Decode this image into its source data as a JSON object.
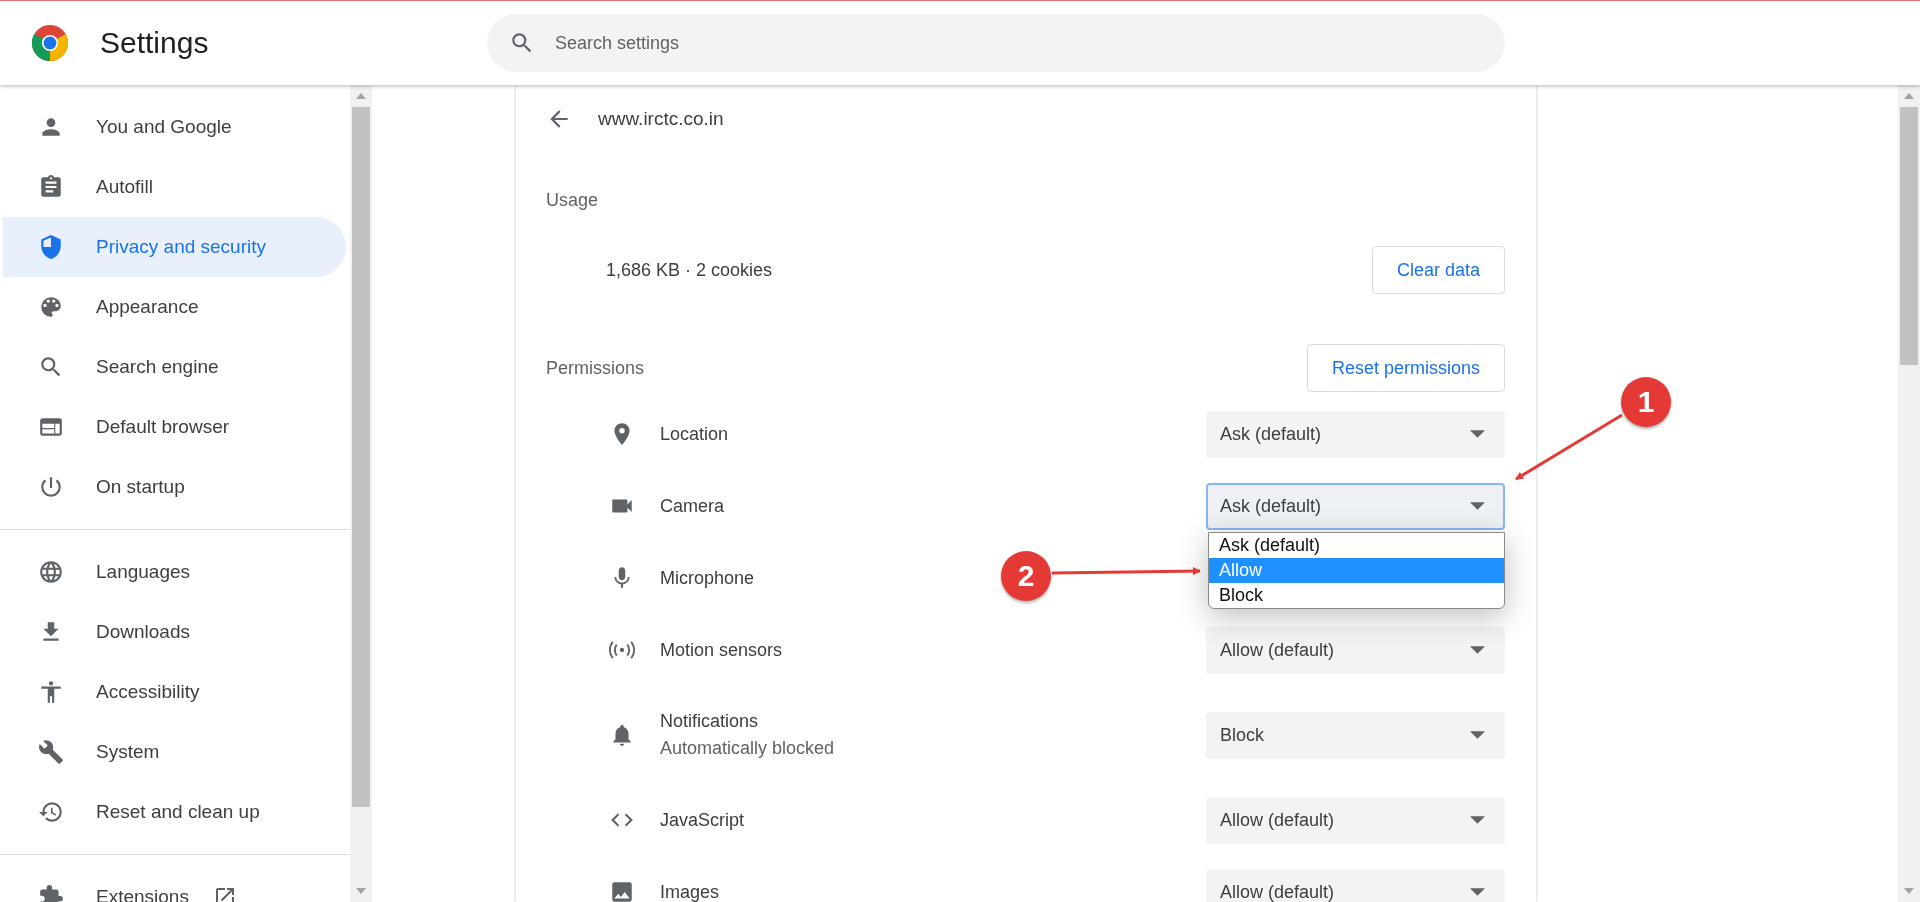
{
  "header": {
    "title": "Settings",
    "search": {
      "placeholder": "Search settings"
    }
  },
  "sidebar": {
    "groups": [
      [
        {
          "label": "You and Google",
          "selected": false
        },
        {
          "label": "Autofill",
          "selected": false
        },
        {
          "label": "Privacy and security",
          "selected": true
        },
        {
          "label": "Appearance",
          "selected": false
        },
        {
          "label": "Search engine",
          "selected": false
        },
        {
          "label": "Default browser",
          "selected": false
        },
        {
          "label": "On startup",
          "selected": false
        }
      ],
      [
        {
          "label": "Languages",
          "selected": false
        },
        {
          "label": "Downloads",
          "selected": false
        },
        {
          "label": "Accessibility",
          "selected": false
        },
        {
          "label": "System",
          "selected": false
        },
        {
          "label": "Reset and clean up",
          "selected": false
        }
      ],
      [
        {
          "label": "Extensions",
          "selected": false,
          "external": true
        }
      ]
    ]
  },
  "site": {
    "title": "www.irctc.co.in",
    "usage": {
      "heading": "Usage",
      "summary": "1,686 KB · 2 cookies",
      "button": "Clear data"
    },
    "permissions": {
      "heading": "Permissions",
      "button": "Reset permissions",
      "items": [
        {
          "label": "Location",
          "value": "Ask (default)"
        },
        {
          "label": "Camera",
          "value": "Ask (default)",
          "focused": true,
          "open": true
        },
        {
          "label": "Microphone"
        },
        {
          "label": "Motion sensors",
          "value": "Allow (default)"
        },
        {
          "label": "Notifications",
          "sublabel": "Automatically blocked",
          "value": "Block"
        },
        {
          "label": "JavaScript",
          "value": "Allow (default)"
        },
        {
          "label": "Images",
          "value": "Allow (default)"
        }
      ]
    },
    "dropdown": {
      "options": [
        {
          "label": "Ask (default)",
          "selected": false
        },
        {
          "label": "Allow",
          "selected": true
        },
        {
          "label": "Block",
          "selected": false
        }
      ]
    }
  },
  "annotations": [
    {
      "number": "1"
    },
    {
      "number": "2"
    }
  ]
}
